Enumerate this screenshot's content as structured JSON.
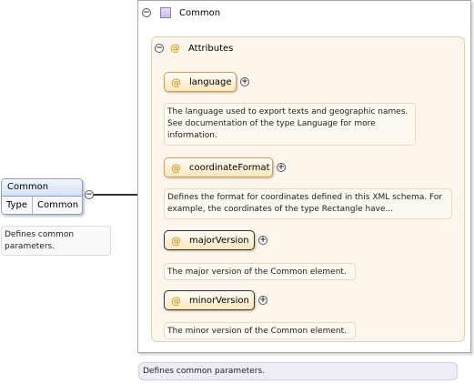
{
  "element": {
    "name": "Common",
    "type_label": "Type",
    "type_value": "Common",
    "annotation": "Defines common parameters."
  },
  "group": {
    "title": "Common",
    "annotation": "Defines common parameters.",
    "attributes_title": "Attributes",
    "attributes": [
      {
        "name": "language",
        "description": "The language used to export texts and geographic names. See documentation of the type Language for more information."
      },
      {
        "name": "coordinateFormat",
        "description": "Defines the format for coordinates defined in this XML schema. For example, the coordinates of the type Rectangle have..."
      },
      {
        "name": "majorVersion",
        "description": "The major version of the Common element."
      },
      {
        "name": "minorVersion",
        "description": "The minor version of the Common element."
      }
    ]
  },
  "symbols": {
    "at": "@",
    "collapse": "−",
    "expand": "+"
  },
  "colors": {
    "element_header": "#d6e2f3",
    "attribute_fill": "#fbe7bd",
    "attribute_border": "#caa15e",
    "panel_fill": "#fcf6ec",
    "group_icon": "#c8bde6"
  }
}
